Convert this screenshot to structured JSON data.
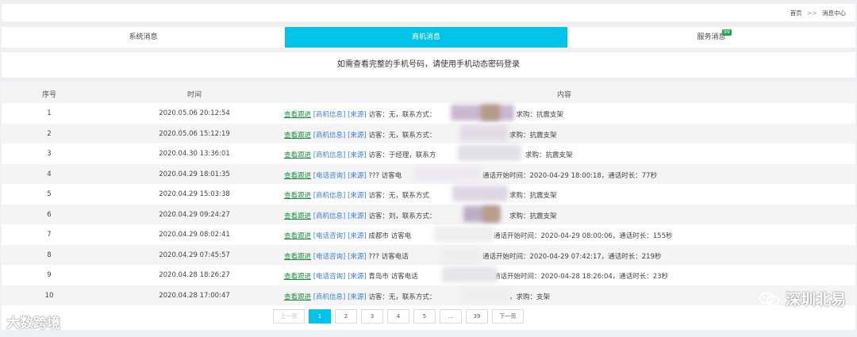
{
  "breadcrumb": {
    "home": "首页",
    "sep": ">>",
    "current": "消息中心"
  },
  "tabs": [
    {
      "label": "系统消息",
      "active": false
    },
    {
      "label": "商机消息",
      "active": true
    },
    {
      "label": "服务消息",
      "active": false,
      "badge": "99"
    }
  ],
  "notice": "如需查看完整的手机号码，请使用手机动态密码登录",
  "table": {
    "headers": {
      "seq": "序号",
      "time": "时间",
      "content": "内容"
    },
    "rows": [
      {
        "seq": "1",
        "time": "2020.05.06 20:12:54",
        "link": "查看跟进",
        "tag": "[商机信息]",
        "src": "[来源]",
        "text": "访客：无，联系方式：",
        "tail": "，求购：抗震支架"
      },
      {
        "seq": "2",
        "time": "2020.05.06 15:12:19",
        "link": "查看跟进",
        "tag": "[商机信息]",
        "src": "[来源]",
        "text": "访客：无，联系方式：",
        "tail": "求购：抗震支架"
      },
      {
        "seq": "3",
        "time": "2020.04.30 13:36:01",
        "link": "查看跟进",
        "tag": "[商机信息]",
        "src": "[来源]",
        "text": "访客：于经理，联系方",
        "tail": "求购：抗震支架"
      },
      {
        "seq": "4",
        "time": "2020.04.29 18:01:35",
        "link": "查看跟进",
        "tag": "[电话咨询]",
        "src": "[来源]",
        "text": "??? 访客电",
        "tail": "通话开始时间：2020-04-29 18:00:18，通话时长：77秒"
      },
      {
        "seq": "5",
        "time": "2020.04.29 15:03:38",
        "link": "查看跟进",
        "tag": "[商机信息]",
        "src": "[来源]",
        "text": "访客：无，联系方式",
        "tail": "求购：抗震支架"
      },
      {
        "seq": "6",
        "time": "2020.04.29 09:24:27",
        "link": "查看跟进",
        "tag": "[商机信息]",
        "src": "[来源]",
        "text": "访客：刘，联系方式：",
        "tail": "求购：抗震支架"
      },
      {
        "seq": "7",
        "time": "2020.04.29 08:02:41",
        "link": "查看跟进",
        "tag": "[电话咨询]",
        "src": "[来源]",
        "text": "成都市 访客电",
        "tail": "通话开始时间：2020-04-29 08:00:06，通话时长：155秒"
      },
      {
        "seq": "8",
        "time": "2020.04.29 07:45:57",
        "link": "查看跟进",
        "tag": "[电话咨询]",
        "src": "[来源]",
        "text": "??? 访客电话",
        "tail": "通话开始时间：2020-04-29 07:42:17，通话时长：219秒"
      },
      {
        "seq": "9",
        "time": "2020.04.28 18:26:27",
        "link": "查看跟进",
        "tag": "[电话咨询]",
        "src": "[来源]",
        "text": "青岛市 访客电话",
        "tail": "通话开始时间：2020-04-28 18:26:04，通话时长：23秒"
      },
      {
        "seq": "10",
        "time": "2020.04.28 17:00:47",
        "link": "查看跟进",
        "tag": "[商机信息]",
        "src": "[来源]",
        "text": "访客：无，联系方式：",
        "tail": "，求购：支架"
      }
    ]
  },
  "pager": {
    "prev": "上一页",
    "pages": [
      "1",
      "2",
      "3",
      "4",
      "5",
      "...",
      "39"
    ],
    "current": "1",
    "next": "下一页"
  },
  "watermark_left": "大数跨境",
  "watermark_right": "深圳北易",
  "colors": {
    "accent": "#00c3ea",
    "link_green": "#1a8f3e",
    "link_blue": "#3b7dd8",
    "badge": "#22a84a"
  }
}
